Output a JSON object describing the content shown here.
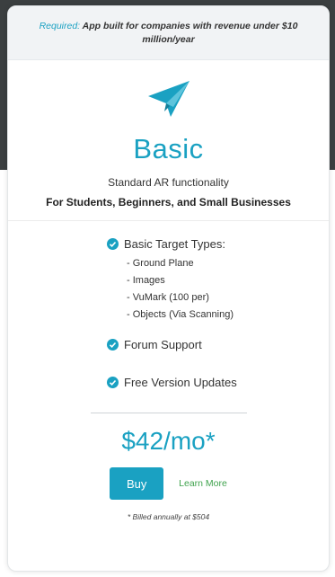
{
  "notice": {
    "required_label": "Required:",
    "text": "App built for companies with revenue under $10 million/year"
  },
  "plan": {
    "icon": "paper-plane-icon",
    "name": "Basic",
    "subtitle": "Standard AR functionality",
    "audience": "For Students, Beginners, and Small Businesses"
  },
  "features": {
    "target_types": {
      "label": "Basic Target Types:",
      "items": [
        "- Ground Plane",
        "- Images",
        "- VuMark (100 per)",
        "- Objects (Via Scanning)"
      ]
    },
    "forum": "Forum Support",
    "updates": "Free Version Updates"
  },
  "pricing": {
    "price": "$42/mo*",
    "buy_label": "Buy",
    "learn_more_label": "Learn More",
    "footnote": "* Billed annually at $504"
  },
  "colors": {
    "accent": "#1aa1c2",
    "link_green": "#3fa34d",
    "header_dark": "#3b3f40"
  }
}
